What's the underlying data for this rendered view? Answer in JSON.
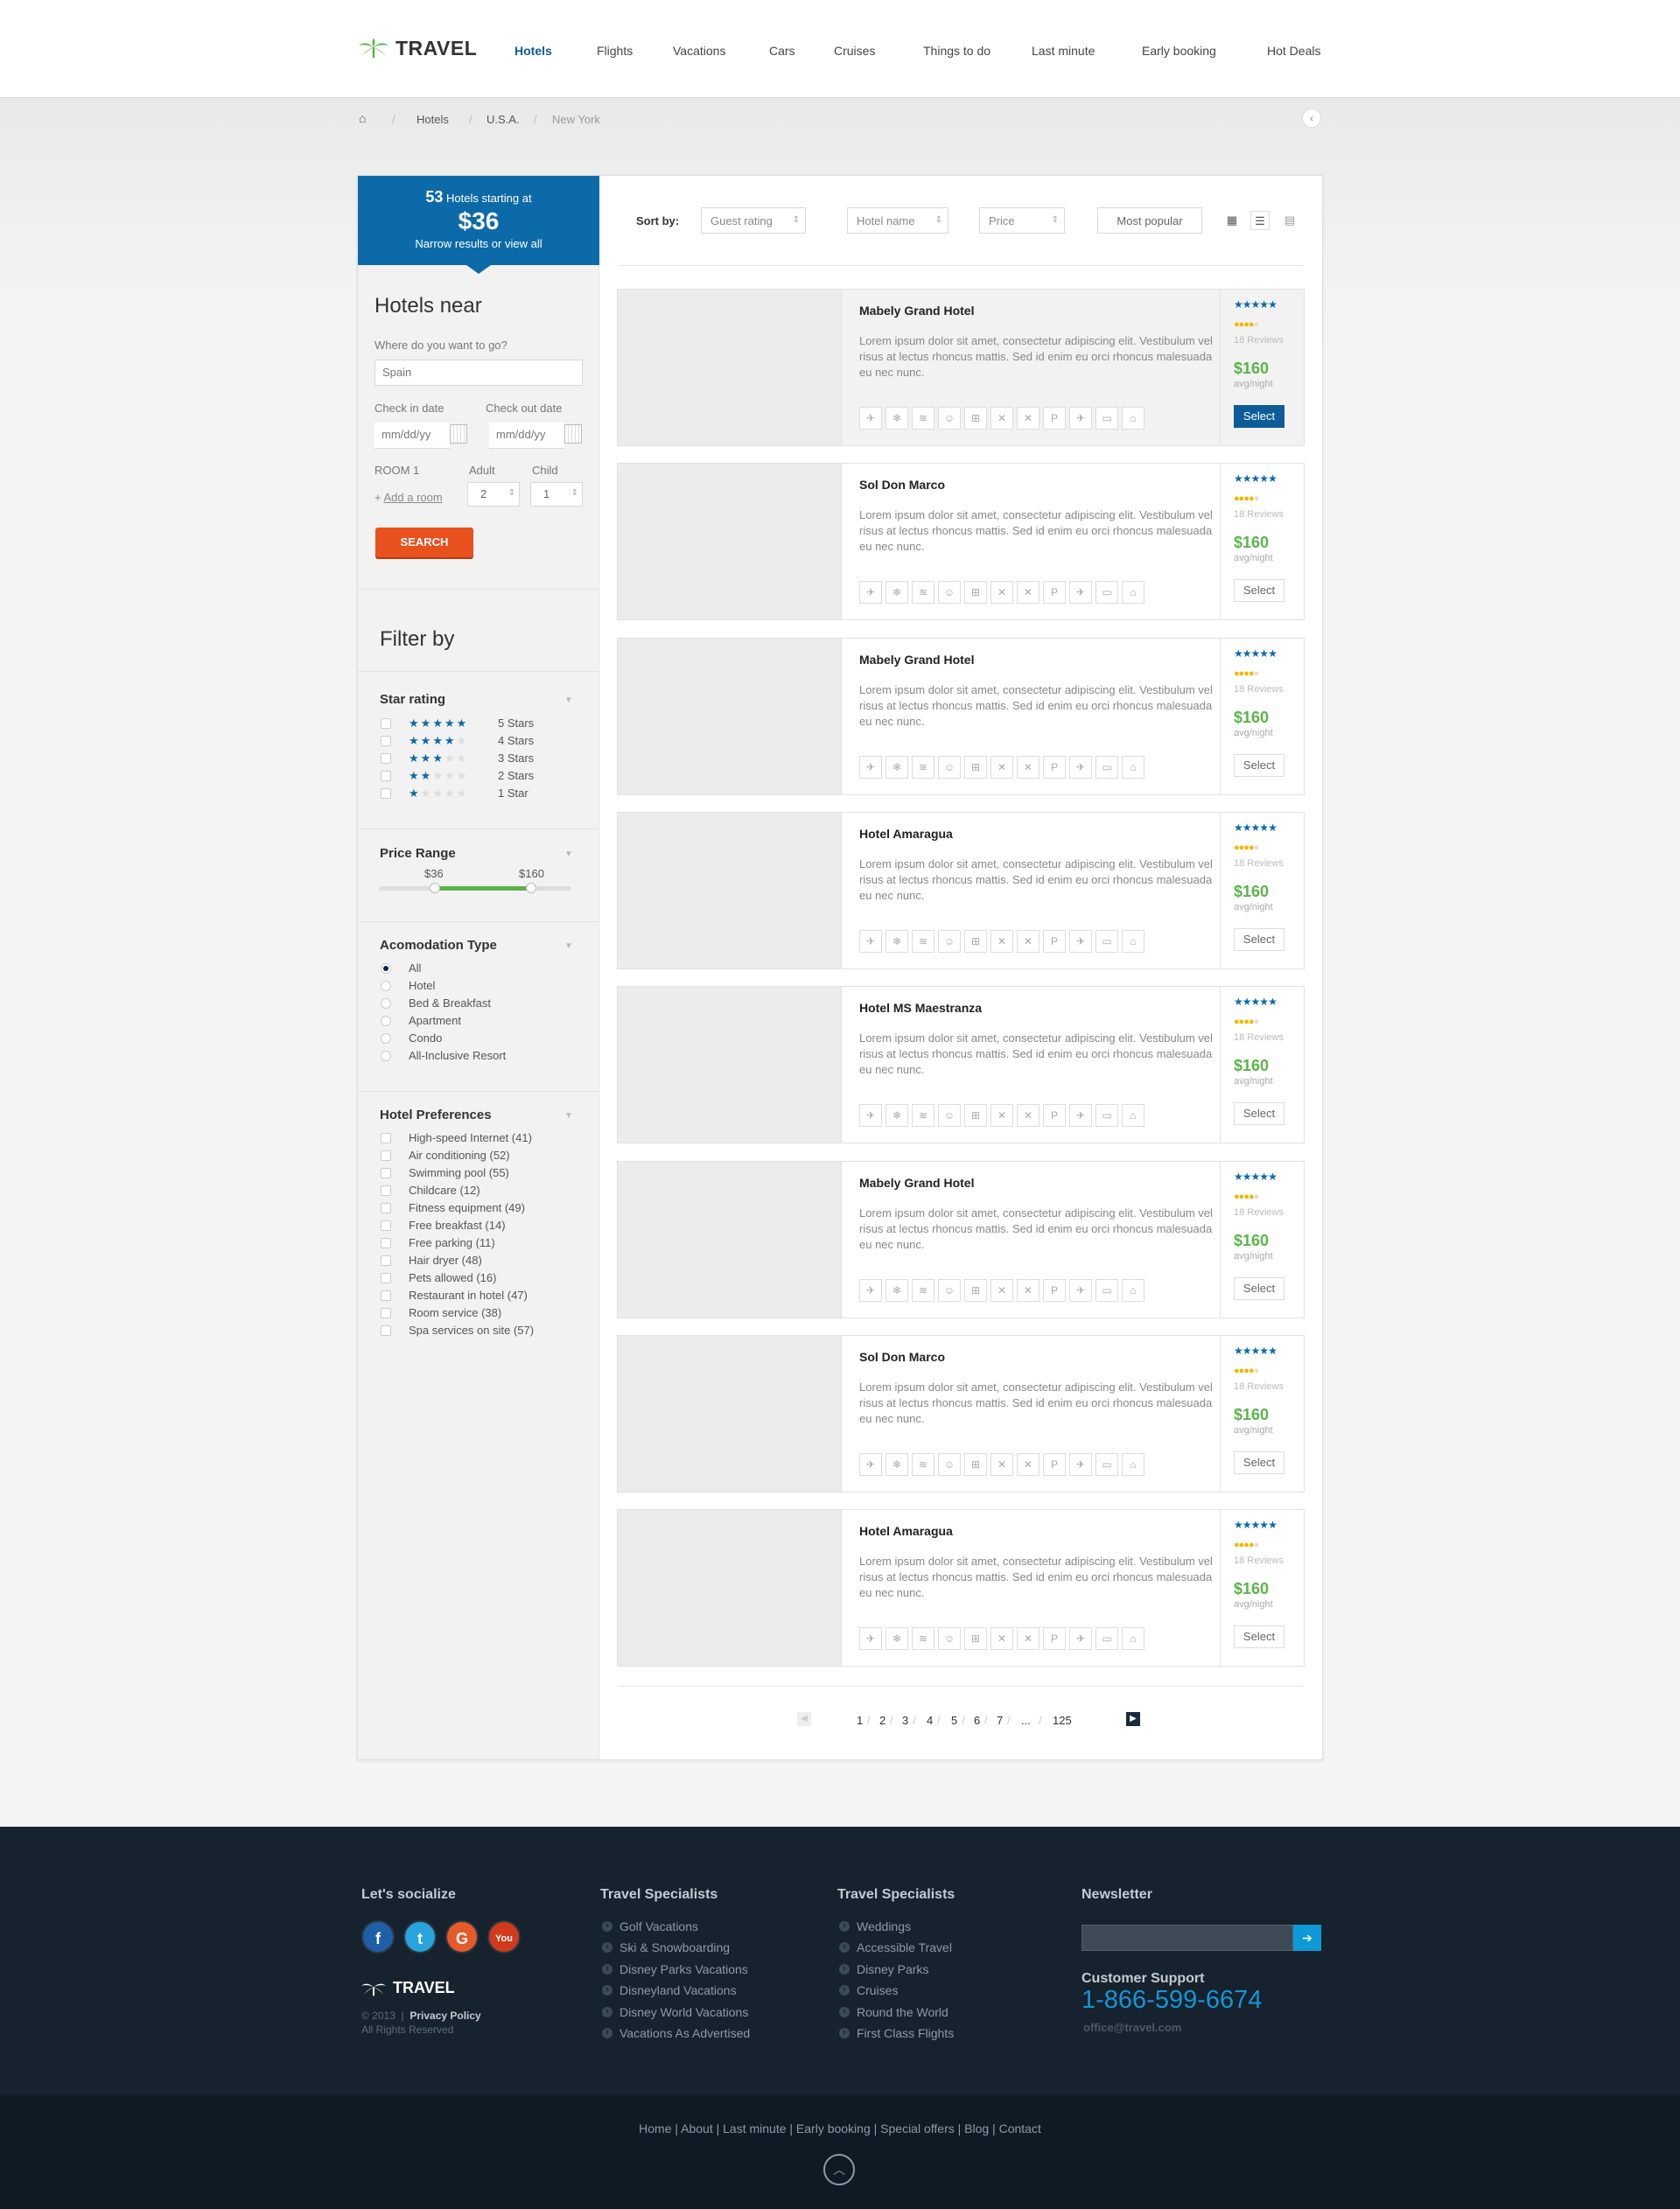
{
  "header": {
    "logo_text": "TRAVEL",
    "nav": [
      {
        "label": "Hotels",
        "active": true
      },
      {
        "label": "Flights"
      },
      {
        "label": "Vacations"
      },
      {
        "label": "Cars"
      },
      {
        "label": "Cruises"
      },
      {
        "label": "Things to do"
      },
      {
        "label": "Last minute"
      },
      {
        "label": "Early booking"
      },
      {
        "label": "Hot Deals"
      }
    ]
  },
  "breadcrumb": {
    "home_icon": "home-icon",
    "sep": "/",
    "items": [
      "Hotels",
      "U.S.A.",
      "New York"
    ]
  },
  "banner": {
    "count": "53",
    "count_text": "Hotels starting at",
    "price": "$36",
    "sub": "Narrow results or view all"
  },
  "search": {
    "title": "Hotels near",
    "where_label": "Where do you want to go?",
    "where_value": "Spain",
    "checkin_label": "Check in date",
    "checkout_label": "Check out date",
    "date_placeholder": "mm/dd/yy",
    "room_label": "ROOM 1",
    "adult_label": "Adult",
    "child_label": "Child",
    "add_room_prefix": "+",
    "add_room": "Add a room",
    "adult_value": "2",
    "child_value": "1",
    "button": "SEARCH"
  },
  "filters": {
    "title": "Filter by",
    "star": {
      "title": "Star rating",
      "options": [
        {
          "stars": 5,
          "label": "5 Stars"
        },
        {
          "stars": 4,
          "label": "4 Stars"
        },
        {
          "stars": 3,
          "label": "3 Stars"
        },
        {
          "stars": 2,
          "label": "2 Stars"
        },
        {
          "stars": 1,
          "label": "1 Star"
        }
      ]
    },
    "price": {
      "title": "Price Range",
      "min_label": "$36",
      "max_label": "$160",
      "low_fraction": 0.29,
      "high_fraction": 0.79
    },
    "acc": {
      "title": "Acomodation Type",
      "selected": "All",
      "options": [
        "All",
        "Hotel",
        "Bed & Breakfast",
        "Apartment",
        "Condo",
        "All-Inclusive Resort"
      ]
    },
    "prefs": {
      "title": "Hotel Preferences",
      "options": [
        "High-speed Internet (41)",
        "Air conditioning (52)",
        "Swimming pool (55)",
        "Childcare (12)",
        "Fitness equipment (49)",
        "Free breakfast (14)",
        "Free parking (11)",
        "Hair dryer (48)",
        "Pets allowed (16)",
        "Restaurant in hotel (47)",
        "Room service (38)",
        "Spa services on site (57)"
      ]
    }
  },
  "sort": {
    "label": "Sort by:",
    "options": [
      "Guest rating",
      "Hotel name",
      "Price",
      "Most popular"
    ],
    "view_icons": [
      "grid-view-icon",
      "list-view-icon",
      "table-view-icon"
    ]
  },
  "amenity_icons": [
    "wifi-icon",
    "ac-icon",
    "pool-icon",
    "childcare-icon",
    "fitness-icon",
    "breakfast-icon",
    "parking-x-icon",
    "parking-icon",
    "pets-icon",
    "restaurant-icon",
    "room-service-icon"
  ],
  "amenity_glyphs": [
    "✈",
    "❄",
    "≋",
    "☺",
    "⊞",
    "✕",
    "✕",
    "P",
    "✈",
    "▭",
    "⌂"
  ],
  "hotels": [
    {
      "name": "Mabely Grand Hotel",
      "stars": 5,
      "rating": 4,
      "reviews": "18 Reviews",
      "price": "$160",
      "per": "avg/night",
      "button": "Select",
      "featured": true,
      "desc": "Lorem ipsum dolor sit amet, consectetur adipiscing elit. Vestibulum vel risus at lectus rhoncus mattis. Sed id enim eu orci rhoncus malesuada eu nec nunc."
    },
    {
      "name": "Sol Don Marco",
      "stars": 5,
      "rating": 4,
      "reviews": "18 Reviews",
      "price": "$160",
      "per": "avg/night",
      "button": "Select",
      "desc": "Lorem ipsum dolor sit amet, consectetur adipiscing elit. Vestibulum vel risus at lectus rhoncus mattis. Sed id enim eu orci rhoncus malesuada eu nec nunc."
    },
    {
      "name": "Mabely Grand Hotel",
      "stars": 5,
      "rating": 4,
      "reviews": "18 Reviews",
      "price": "$160",
      "per": "avg/night",
      "button": "Select",
      "desc": "Lorem ipsum dolor sit amet, consectetur adipiscing elit. Vestibulum vel risus at lectus rhoncus mattis. Sed id enim eu orci rhoncus malesuada eu nec nunc."
    },
    {
      "name": "Hotel Amaragua",
      "stars": 5,
      "rating": 4,
      "reviews": "18 Reviews",
      "price": "$160",
      "per": "avg/night",
      "button": "Select",
      "desc": "Lorem ipsum dolor sit amet, consectetur adipiscing elit. Vestibulum vel risus at lectus rhoncus mattis. Sed id enim eu orci rhoncus malesuada eu nec nunc."
    },
    {
      "name": "Hotel MS Maestranza",
      "stars": 5,
      "rating": 4,
      "reviews": "18 Reviews",
      "price": "$160",
      "per": "avg/night",
      "button": "Select",
      "desc": "Lorem ipsum dolor sit amet, consectetur adipiscing elit. Vestibulum vel risus at lectus rhoncus mattis. Sed id enim eu orci rhoncus malesuada eu nec nunc."
    },
    {
      "name": "Mabely Grand Hotel",
      "stars": 5,
      "rating": 4,
      "reviews": "18 Reviews",
      "price": "$160",
      "per": "avg/night",
      "button": "Select",
      "desc": "Lorem ipsum dolor sit amet, consectetur adipiscing elit. Vestibulum vel risus at lectus rhoncus mattis. Sed id enim eu orci rhoncus malesuada eu nec nunc."
    },
    {
      "name": "Sol Don Marco",
      "stars": 5,
      "rating": 4,
      "reviews": "18 Reviews",
      "price": "$160",
      "per": "avg/night",
      "button": "Select",
      "desc": "Lorem ipsum dolor sit amet, consectetur adipiscing elit. Vestibulum vel risus at lectus rhoncus mattis. Sed id enim eu orci rhoncus malesuada eu nec nunc."
    },
    {
      "name": "Hotel Amaragua",
      "stars": 5,
      "rating": 4,
      "reviews": "18 Reviews",
      "price": "$160",
      "per": "avg/night",
      "button": "Select",
      "desc": "Lorem ipsum dolor sit amet, consectetur adipiscing elit. Vestibulum vel risus at lectus rhoncus mattis. Sed id enim eu orci rhoncus malesuada eu nec nunc."
    }
  ],
  "pagination": {
    "pages": [
      "1",
      "2",
      "3",
      "4",
      "5",
      "6",
      "7",
      "...",
      "125"
    ],
    "sep": "/"
  },
  "footer": {
    "social_title": "Let's socialize",
    "social": [
      {
        "name": "facebook-icon",
        "glyph": "f",
        "color": "#1f5fa8"
      },
      {
        "name": "twitter-icon",
        "glyph": "t",
        "color": "#27a3dd"
      },
      {
        "name": "google-plus-icon",
        "glyph": "G",
        "color": "#e65a2a"
      },
      {
        "name": "youtube-icon",
        "glyph": "You",
        "color": "#d13a1c"
      }
    ],
    "logo_text": "TRAVEL",
    "copy_year": "© 2013",
    "copy_sep": "|",
    "privacy": "Privacy Policy",
    "rights": "All Rights Reserved",
    "col1": {
      "title": "Travel Specialists",
      "links": [
        "Golf Vacations",
        "Ski & Snowboarding",
        "Disney Parks Vacations",
        "Disneyland Vacations",
        "Disney World Vacations",
        "Vacations As Advertised"
      ]
    },
    "col2": {
      "title": "Travel Specialists",
      "links": [
        "Weddings",
        "Accessible Travel",
        "Disney Parks",
        "Cruises",
        "Round the World",
        "First Class Flights"
      ]
    },
    "newsletter_title": "Newsletter",
    "support_title": "Customer Support",
    "phone": "1-866-599-6674",
    "email": "office@travel.com",
    "bottom_links": "Home | About | Last minute | Early booking | Special offers | Blog | Contact"
  },
  "colors": {
    "brand": "#0d6aa8",
    "accent": "#e8501e",
    "price": "#5ab44a",
    "footer": "#16222e"
  }
}
